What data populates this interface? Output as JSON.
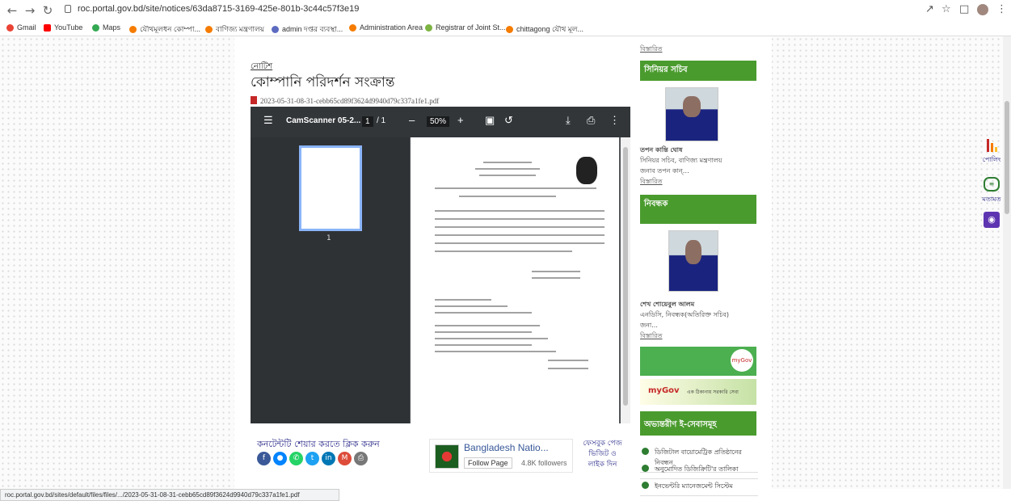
{
  "browser": {
    "url": "roc.portal.gov.bd/site/notices/63da8715-3169-425e-801b-3c44c57f3e19",
    "bookmarks": [
      "Gmail",
      "YouTube",
      "Maps",
      "যৌথমূলধন কোম্পা...",
      "বাণিজ্য মন্ত্রণালয়",
      "admin দপ্তর ব্যবস্থা...",
      "Administration Area",
      "Registrar of Joint St...",
      "chittagong যৌথ মূল..."
    ],
    "status": "roc.portal.gov.bd/sites/default/files/files/.../2023-05-31-08-31-cebb65cd89f3624d9940d79c337a1fe1.pdf"
  },
  "notice": {
    "breadcrumb": "নোটিশ",
    "title": "কোম্পানি পরিদর্শন সংক্রান্ত",
    "file": "2023-05-31-08-31-cebb65cd89f3624d9940d79c337a1fe1.pdf"
  },
  "viewer": {
    "doc_title": "CamScanner 05-2...",
    "page": "1",
    "pages": "/ 1",
    "zoom": "50%",
    "thumb_label": "1"
  },
  "share": {
    "label": "কনটেন্টটি শেয়ার করতে ক্লিক করুন"
  },
  "fb": {
    "name": "Bangladesh Natio...",
    "follow": "Follow Page",
    "followers": "4.8K followers",
    "note": "ফেসবুক পেজ ভিজিট ও লাইক দিন"
  },
  "sidebar": {
    "more": "বিস্তারিত",
    "senior_secretary": {
      "heading": "সিনিয়র সচিব",
      "name": "তপন কান্তি ঘোষ",
      "role": "সিনিয়র সচিব, বাণিজ্য মন্ত্রণালয়",
      "note": "জনাব তপন কান্…"
    },
    "registrar": {
      "heading": "নিবন্ধক",
      "name": "শেখ শোয়েবুল আলম",
      "role": "এনডিসি, নিবন্ধক(অতিরিক্ত সচিব)",
      "note": "জনা..."
    },
    "mygov": "myGov",
    "mygov_tag": "এক ঠিকানায় সরকারি সেবা",
    "eservices_heading": "অভ্যন্তরীণ ই-সেবাসমূহ",
    "eservices": [
      "ডিজিটাল বায়োমেট্রিক প্রতিষ্ঠানের নিবন্ধন",
      "অনুমোদিত ডিজিক্রিটি'র তালিকা",
      "ইনভেন্টরি ম্যানেজমেন্ট সিস্টেম"
    ]
  },
  "widgets": {
    "poll": "পোলিং",
    "feedback": "মতামত"
  }
}
